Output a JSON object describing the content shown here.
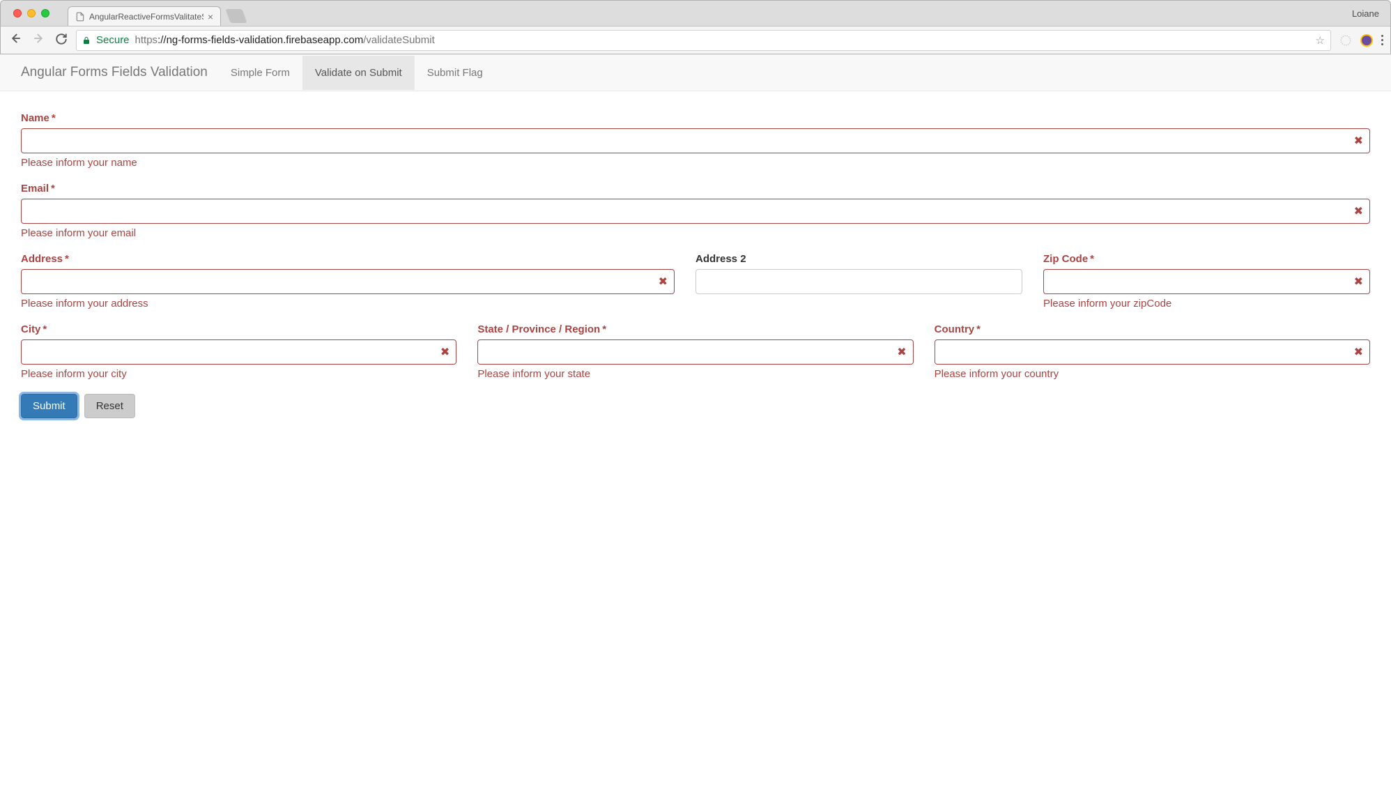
{
  "browser": {
    "tab_title": "AngularReactiveFormsValitateS",
    "profile_name": "Loiane",
    "secure_label": "Secure",
    "url_scheme": "https",
    "url_host": "://ng-forms-fields-validation.firebaseapp.com",
    "url_path": "/validateSubmit"
  },
  "navbar": {
    "brand": "Angular Forms Fields Validation",
    "items": [
      {
        "label": "Simple Form",
        "active": false
      },
      {
        "label": "Validate on Submit",
        "active": true
      },
      {
        "label": "Submit Flag",
        "active": false
      }
    ]
  },
  "form": {
    "name": {
      "label": "Name",
      "required": "*",
      "value": "",
      "error": "Please inform your name",
      "has_error": true
    },
    "email": {
      "label": "Email",
      "required": "*",
      "value": "",
      "error": "Please inform your email",
      "has_error": true
    },
    "address": {
      "label": "Address",
      "required": "*",
      "value": "",
      "error": "Please inform your address",
      "has_error": true
    },
    "address2": {
      "label": "Address 2",
      "value": "",
      "has_error": false
    },
    "zipcode": {
      "label": "Zip Code",
      "required": "*",
      "value": "",
      "error": "Please inform your zipCode",
      "has_error": true
    },
    "city": {
      "label": "City",
      "required": "*",
      "value": "",
      "error": "Please inform your city",
      "has_error": true
    },
    "state": {
      "label": "State / Province / Region",
      "required": "*",
      "value": "",
      "error": "Please inform your state",
      "has_error": true
    },
    "country": {
      "label": "Country",
      "required": "*",
      "value": "",
      "error": "Please inform your country",
      "has_error": true
    },
    "buttons": {
      "submit": "Submit",
      "reset": "Reset"
    }
  }
}
